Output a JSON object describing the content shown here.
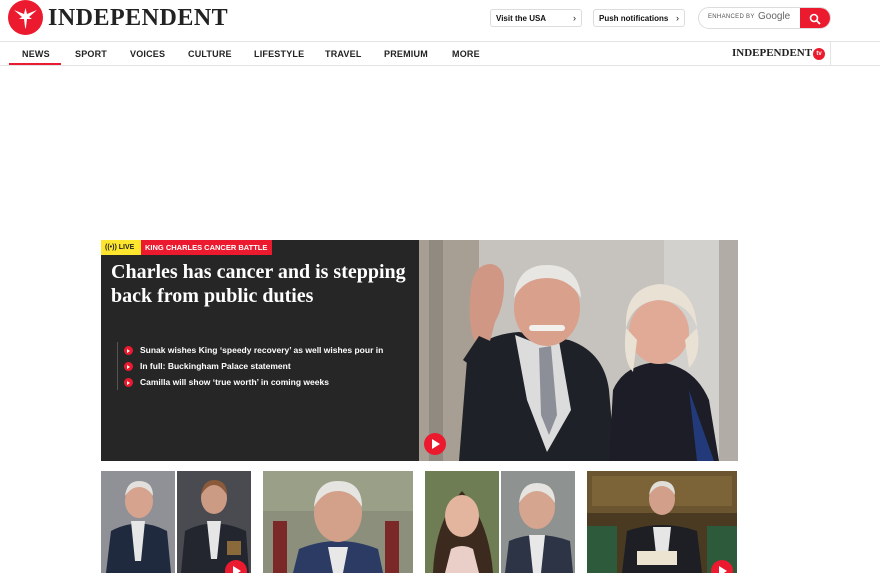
{
  "brand": {
    "name": "INDEPENDENT",
    "tv_name": "INDEPENDENT",
    "tv_badge": "tv"
  },
  "header": {
    "visit_usa": "Visit the USA",
    "push_notifications": "Push notifications",
    "search_enhanced": "ENHANCED BY",
    "search_google": "Google"
  },
  "nav": {
    "items": [
      "NEWS",
      "SPORT",
      "VOICES",
      "CULTURE",
      "LIFESTYLE",
      "TRAVEL",
      "PREMIUM",
      "MORE"
    ],
    "active": "NEWS"
  },
  "hero": {
    "live_label": "LIVE",
    "live_icon": "((•))",
    "tag": "KING CHARLES CANCER BATTLE",
    "headline": "Charles has cancer and is stepping back from public duties",
    "bullets": [
      "Sunak wishes King ‘speedy recovery’ as well wishes pour in",
      "In full: Buckingham Palace statement",
      "Camilla will show ‘true worth’ in coming weeks"
    ]
  },
  "colors": {
    "brand_red": "#ec1a2e",
    "live_yellow": "#ffe62e",
    "hero_dark": "#262626"
  }
}
